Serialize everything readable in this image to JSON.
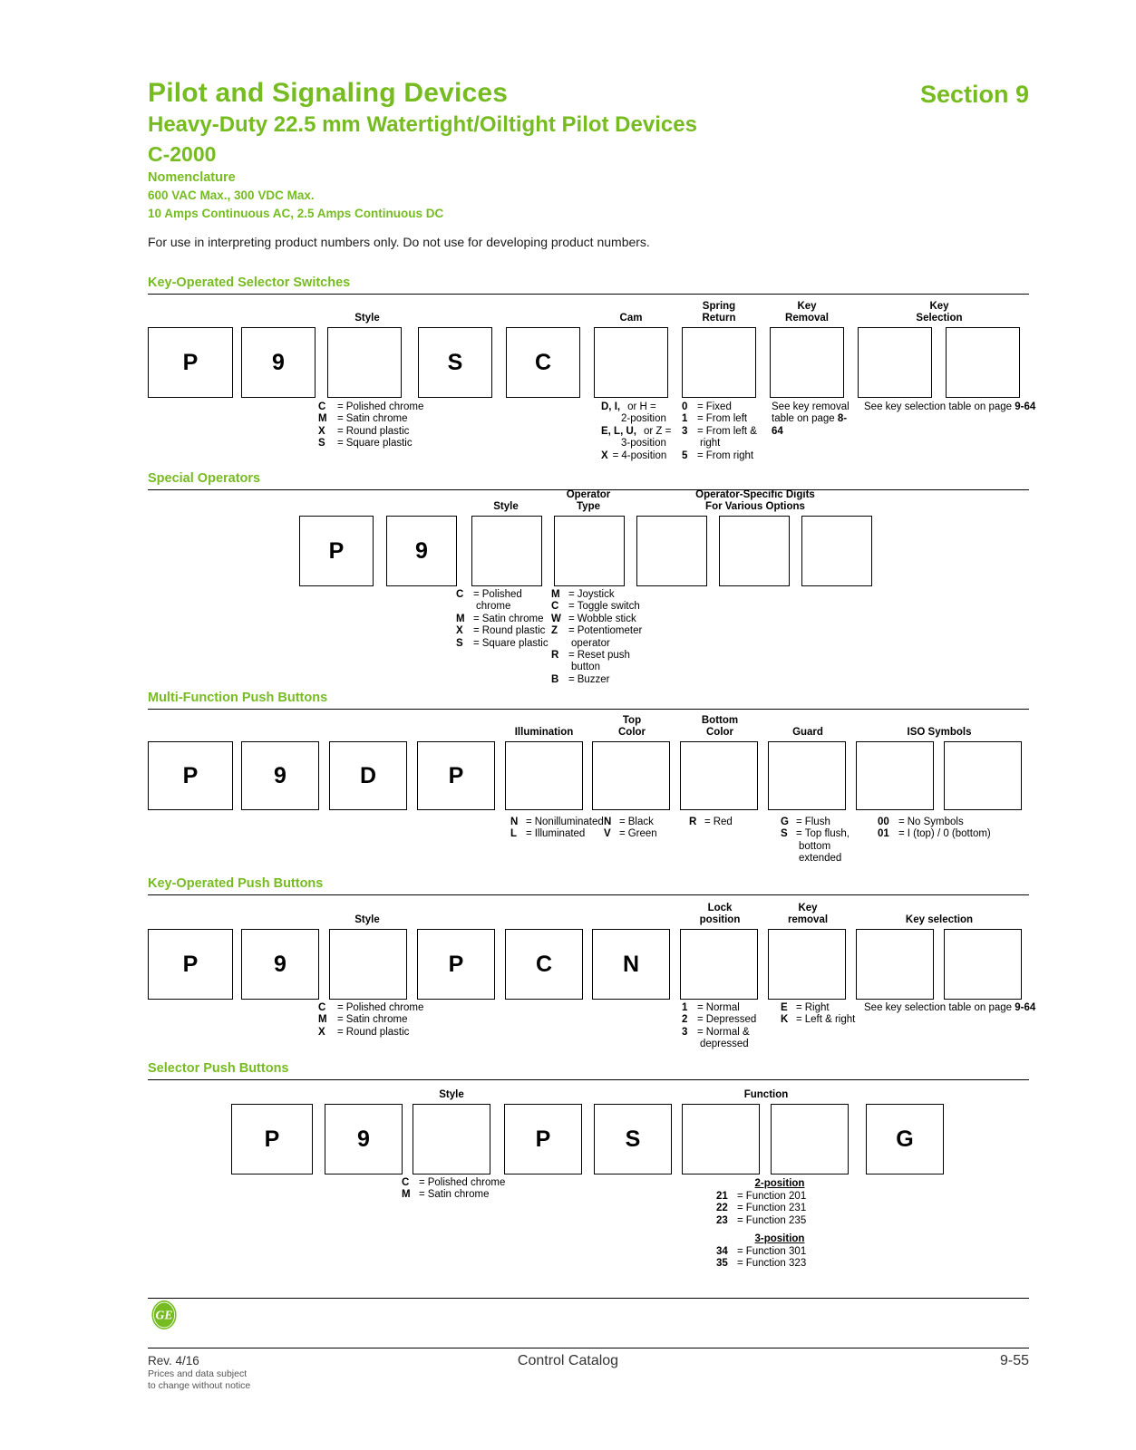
{
  "header": {
    "title": "Pilot and Signaling Devices",
    "section": "Section 9",
    "subtitle": "Heavy-Duty 22.5 mm Watertight/Oiltight Pilot Devices",
    "code": "C-2000",
    "nomenclature": "Nomenclature",
    "spec_line1": "600 VAC Max., 300 VDC Max.",
    "spec_line2": "10 Amps Continuous AC, 2.5 Amps Continuous DC",
    "note": "For use in interpreting product numbers only. Do not use for developing product numbers."
  },
  "accent_color": "#76bc21",
  "sections": [
    {
      "title": "Key-Operated Selector Switches",
      "group_labels": [
        {
          "text": "Style",
          "lines": [
            "Style"
          ]
        },
        {
          "text": "Cam",
          "lines": [
            "Cam"
          ]
        },
        {
          "text": "Spring Return",
          "lines": [
            "Spring",
            "Return"
          ]
        },
        {
          "text": "Key Removal",
          "lines": [
            "Key",
            "Removal"
          ]
        },
        {
          "text": "Key Selection",
          "lines": [
            "Key",
            "Selection"
          ]
        }
      ],
      "boxes": [
        "P",
        "9",
        "",
        "S",
        "C",
        "",
        "",
        "",
        "",
        ""
      ],
      "legends": [
        {
          "name": "style",
          "items": [
            {
              "key": "C",
              "value": "Polished chrome"
            },
            {
              "key": "M",
              "value": "Satin chrome"
            },
            {
              "key": "X",
              "value": "Round plastic"
            },
            {
              "key": "S",
              "value": "Square plastic"
            }
          ]
        },
        {
          "name": "cam",
          "items": [
            {
              "key": "D, I,",
              "key_suffix": "or H =",
              "value": "",
              "cont": "2-position"
            },
            {
              "key": "E, L, U,",
              "key_suffix": "or Z =",
              "value": "",
              "cont": "3-position"
            },
            {
              "key": "X",
              "value": "4-position"
            }
          ]
        },
        {
          "name": "spring-return",
          "items": [
            {
              "key": "0",
              "value": "Fixed"
            },
            {
              "key": "1",
              "value": "From left"
            },
            {
              "key": "3",
              "value": "From left &",
              "cont": "right"
            },
            {
              "key": "5",
              "value": "From right"
            }
          ]
        },
        {
          "name": "key-removal",
          "text": "See key removal table on page 8-64"
        },
        {
          "name": "key-selection",
          "text": "See key selection table on page 9-64"
        }
      ]
    },
    {
      "title": "Special Operators",
      "group_labels": [
        {
          "text": "Style",
          "lines": [
            "Style"
          ]
        },
        {
          "text": "Operator Type",
          "lines": [
            "Operator",
            "Type"
          ]
        },
        {
          "text": "Operator-Specific Digits For Various Options",
          "lines": [
            "Operator-Specific Digits",
            "For Various Options"
          ]
        }
      ],
      "boxes": [
        "P",
        "9",
        "",
        "",
        "",
        "",
        ""
      ],
      "legends": [
        {
          "name": "style",
          "items": [
            {
              "key": "C",
              "value": "Polished",
              "cont": "chrome"
            },
            {
              "key": "M",
              "value": "Satin chrome"
            },
            {
              "key": "X",
              "value": "Round plastic"
            },
            {
              "key": "S",
              "value": "Square plastic"
            }
          ]
        },
        {
          "name": "operator-type",
          "items": [
            {
              "key": "M",
              "value": "Joystick"
            },
            {
              "key": "C",
              "value": "Toggle switch"
            },
            {
              "key": "W",
              "value": "Wobble stick"
            },
            {
              "key": "Z",
              "value": "Potentiometer",
              "cont": "operator"
            },
            {
              "key": "R",
              "value": "Reset push",
              "cont": "button"
            },
            {
              "key": "B",
              "value": "Buzzer"
            }
          ]
        }
      ]
    },
    {
      "title": "Multi-Function Push Buttons",
      "group_labels": [
        {
          "text": "Illumination",
          "lines": [
            "Illumination"
          ]
        },
        {
          "text": "Top Color",
          "lines": [
            "Top",
            "Color"
          ]
        },
        {
          "text": "Bottom Color",
          "lines": [
            "Bottom",
            "Color"
          ]
        },
        {
          "text": "Guard",
          "lines": [
            "Guard"
          ]
        },
        {
          "text": "ISO Symbols",
          "lines": [
            "ISO Symbols"
          ]
        }
      ],
      "boxes": [
        "P",
        "9",
        "D",
        "P",
        "",
        "",
        "",
        "",
        "",
        ""
      ],
      "legends": [
        {
          "name": "illumination",
          "items": [
            {
              "key": "N",
              "value": "Nonilluminated"
            },
            {
              "key": "L",
              "value": "Illuminated"
            }
          ]
        },
        {
          "name": "top-color",
          "items": [
            {
              "key": "N",
              "value": "Black"
            },
            {
              "key": "V",
              "value": "Green"
            }
          ]
        },
        {
          "name": "bottom-color",
          "items": [
            {
              "key": "R",
              "value": "Red"
            }
          ]
        },
        {
          "name": "guard",
          "items": [
            {
              "key": "G",
              "value": "Flush"
            },
            {
              "key": "S",
              "value": "Top flush,",
              "cont": "bottom",
              "cont2": "extended"
            }
          ]
        },
        {
          "name": "iso-symbols",
          "items": [
            {
              "key": "00",
              "value": "No Symbols"
            },
            {
              "key": "01",
              "value": "I (top) / 0 (bottom)"
            }
          ]
        }
      ]
    },
    {
      "title": "Key-Operated Push Buttons",
      "group_labels": [
        {
          "text": "Style",
          "lines": [
            "Style"
          ]
        },
        {
          "text": "Lock position",
          "lines": [
            "Lock",
            "position"
          ]
        },
        {
          "text": "Key removal",
          "lines": [
            "Key",
            "removal"
          ]
        },
        {
          "text": "Key selection",
          "lines": [
            "Key selection"
          ]
        }
      ],
      "boxes": [
        "P",
        "9",
        "",
        "P",
        "C",
        "N",
        "",
        "",
        "",
        ""
      ],
      "legends": [
        {
          "name": "style",
          "items": [
            {
              "key": "C",
              "value": "Polished chrome"
            },
            {
              "key": "M",
              "value": "Satin chrome"
            },
            {
              "key": "X",
              "value": "Round plastic"
            }
          ]
        },
        {
          "name": "lock-position",
          "items": [
            {
              "key": "1",
              "value": "Normal"
            },
            {
              "key": "2",
              "value": "Depressed"
            },
            {
              "key": "3",
              "value": "Normal &",
              "cont": "depressed"
            }
          ]
        },
        {
          "name": "key-removal",
          "items": [
            {
              "key": "E",
              "value": "Right"
            },
            {
              "key": "K",
              "value": "Left & right"
            }
          ]
        },
        {
          "name": "key-selection",
          "text": "See key selection table on page 9-64"
        }
      ]
    },
    {
      "title": "Selector Push Buttons",
      "group_labels": [
        {
          "text": "Style",
          "lines": [
            "Style"
          ]
        },
        {
          "text": "Function",
          "lines": [
            "Function"
          ]
        }
      ],
      "boxes": [
        "P",
        "9",
        "",
        "P",
        "S",
        "",
        "",
        "G"
      ],
      "legends": [
        {
          "name": "style",
          "items": [
            {
              "key": "C",
              "value": "Polished chrome"
            },
            {
              "key": "M",
              "value": "Satin chrome"
            }
          ]
        },
        {
          "name": "function-2position",
          "group": "2-position",
          "items": [
            {
              "key": "21",
              "value": "Function 201"
            },
            {
              "key": "22",
              "value": "Function 231"
            },
            {
              "key": "23",
              "value": "Function 235"
            }
          ]
        },
        {
          "name": "function-3position",
          "group": "3-position",
          "items": [
            {
              "key": "34",
              "value": "Function 301"
            },
            {
              "key": "35",
              "value": "Function 323"
            }
          ]
        }
      ]
    }
  ],
  "footer": {
    "revision": "Rev. 4/16",
    "disclaimer_line1": "Prices and data subject",
    "disclaimer_line2": "to change without notice",
    "catalog": "Control Catalog",
    "page": "9-55",
    "logo": "ge-logo"
  }
}
